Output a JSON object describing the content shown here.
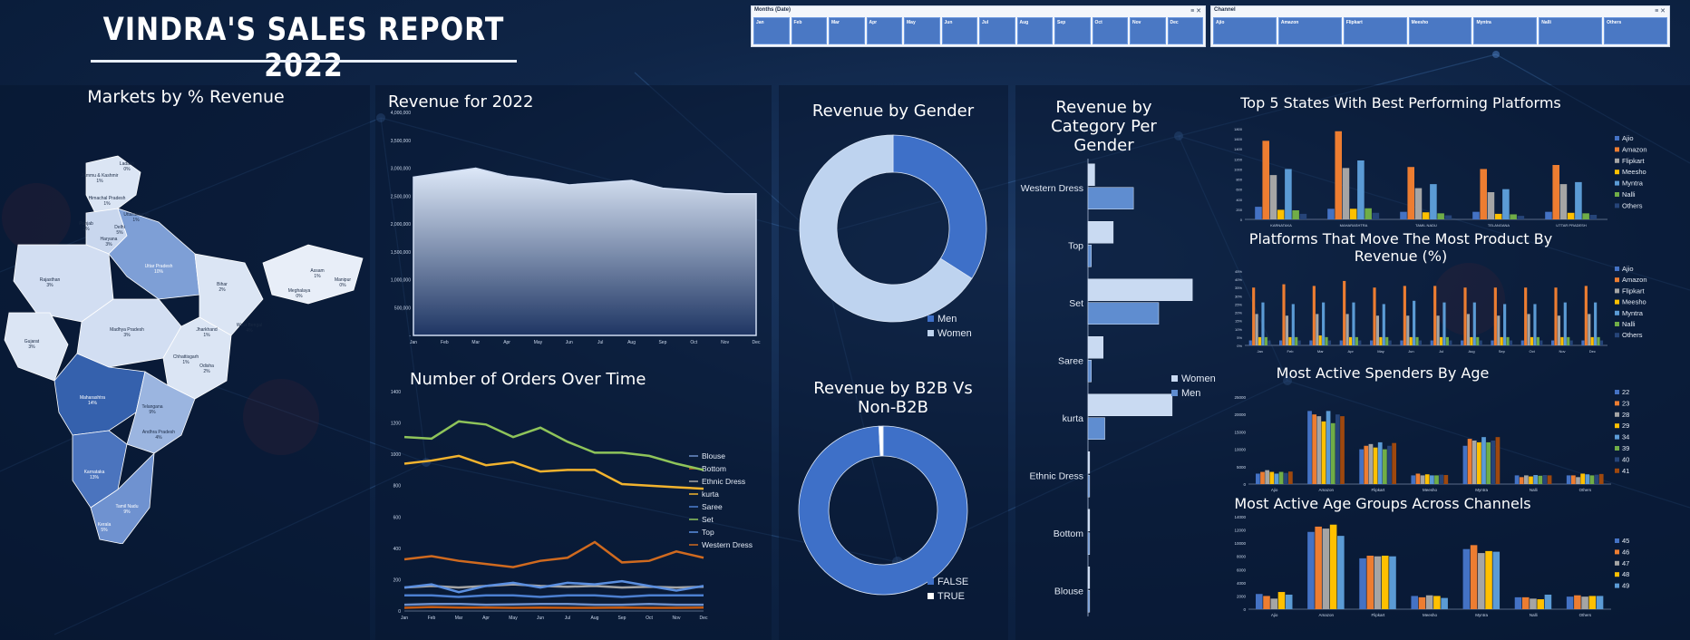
{
  "report_title": "VINDRA'S SALES REPORT 2022",
  "slicers": {
    "months": {
      "header": "Months (Date)",
      "items": [
        "Jan",
        "Feb",
        "Mar",
        "Apr",
        "May",
        "Jun",
        "Jul",
        "Aug",
        "Sep",
        "Oct",
        "Nov",
        "Dec"
      ]
    },
    "channel": {
      "header": "Channel",
      "items": [
        "Ajio",
        "Amazon",
        "Flipkart",
        "Meesho",
        "Myntra",
        "Nalli",
        "Others"
      ]
    }
  },
  "map": {
    "title": "Markets by % Revenue",
    "regions": [
      {
        "name": "Jammu & Kashmir",
        "pct": "1%"
      },
      {
        "name": "Ladakh",
        "pct": "0%"
      },
      {
        "name": "Himachal Pradesh",
        "pct": "1%"
      },
      {
        "name": "Punjab",
        "pct": "2%"
      },
      {
        "name": "Uttarakhand",
        "pct": "1%"
      },
      {
        "name": "Haryana",
        "pct": "3%"
      },
      {
        "name": "Delhi",
        "pct": "5%"
      },
      {
        "name": "Rajasthan",
        "pct": "3%"
      },
      {
        "name": "Uttar Pradesh",
        "pct": "10%"
      },
      {
        "name": "Bihar",
        "pct": "2%"
      },
      {
        "name": "Assam",
        "pct": "1%"
      },
      {
        "name": "Meghalaya",
        "pct": "0%"
      },
      {
        "name": "Manipur",
        "pct": "0%"
      },
      {
        "name": "Gujarat",
        "pct": "3%"
      },
      {
        "name": "Madhya Pradesh",
        "pct": "3%"
      },
      {
        "name": "Jharkhand",
        "pct": "1%"
      },
      {
        "name": "West Bengal",
        "pct": "4%"
      },
      {
        "name": "Chhattisgarh",
        "pct": "1%"
      },
      {
        "name": "Odisha",
        "pct": "2%"
      },
      {
        "name": "Maharashtra",
        "pct": "14%"
      },
      {
        "name": "Telangana",
        "pct": "9%"
      },
      {
        "name": "Andhra Pradesh",
        "pct": "4%"
      },
      {
        "name": "Karnataka",
        "pct": "13%"
      },
      {
        "name": "Tamil Nadu",
        "pct": "9%"
      },
      {
        "name": "Kerala",
        "pct": "5%"
      }
    ]
  },
  "chart_data": [
    {
      "id": "revenue_2022",
      "type": "area",
      "title": "Revenue for 2022",
      "categories": [
        "Jan",
        "Feb",
        "Mar",
        "Apr",
        "May",
        "Jun",
        "Jul",
        "Aug",
        "Sep",
        "Oct",
        "Nov",
        "Dec"
      ],
      "values": [
        2840000,
        2920000,
        3000000,
        2860000,
        2800000,
        2700000,
        2740000,
        2780000,
        2640000,
        2600000,
        2540000,
        2540000
      ],
      "ylim": [
        0,
        4000000
      ],
      "yticks": [
        "-",
        "500,000",
        "1,000,000",
        "1,500,000",
        "2,000,000",
        "2,500,000",
        "3,000,000",
        "3,500,000",
        "4,000,000"
      ],
      "grid": false
    },
    {
      "id": "orders_over_time",
      "type": "line",
      "title": "Number of Orders Over Time",
      "categories": [
        "Jan",
        "Feb",
        "Mar",
        "Apr",
        "May",
        "Jun",
        "Jul",
        "Aug",
        "Sep",
        "Oct",
        "Nov",
        "Dec"
      ],
      "ylim": [
        0,
        1400
      ],
      "yticks": [
        "0",
        "200",
        "400",
        "600",
        "800",
        "1000",
        "1200",
        "1400"
      ],
      "legend": "right",
      "series": [
        {
          "name": "Blouse",
          "color": "#6d8fc9",
          "values": [
            40,
            45,
            45,
            40,
            42,
            45,
            45,
            40,
            40,
            45,
            40,
            40
          ]
        },
        {
          "name": "Bottom",
          "color": "#c55a11",
          "values": [
            20,
            25,
            22,
            22,
            20,
            22,
            20,
            20,
            22,
            20,
            20,
            22
          ]
        },
        {
          "name": "Ethnic Dress",
          "color": "#a5a5a5",
          "values": [
            150,
            160,
            150,
            160,
            170,
            160,
            155,
            160,
            150,
            155,
            150,
            155
          ]
        },
        {
          "name": "kurta",
          "color": "#f2b32e",
          "values": [
            940,
            960,
            990,
            930,
            950,
            890,
            900,
            900,
            810,
            800,
            790,
            780
          ]
        },
        {
          "name": "Saree",
          "color": "#4c7fd0",
          "values": [
            100,
            100,
            90,
            100,
            100,
            90,
            100,
            100,
            90,
            100,
            100,
            100
          ]
        },
        {
          "name": "Set",
          "color": "#8fc45a",
          "values": [
            1110,
            1100,
            1210,
            1190,
            1110,
            1170,
            1080,
            1010,
            1010,
            990,
            940,
            900
          ]
        },
        {
          "name": "Top",
          "color": "#5b8fe0",
          "values": [
            150,
            170,
            120,
            160,
            180,
            150,
            180,
            170,
            190,
            160,
            130,
            160
          ]
        },
        {
          "name": "Western Dress",
          "color": "#d06a1f",
          "values": [
            330,
            350,
            320,
            300,
            280,
            320,
            340,
            440,
            310,
            320,
            380,
            340
          ]
        }
      ]
    },
    {
      "id": "revenue_by_gender",
      "type": "pie",
      "title": "Revenue by Gender",
      "legend": "bottom-right",
      "labels": [
        "Men",
        "Women"
      ],
      "values": [
        34,
        66
      ],
      "colors": [
        "#3e70c8",
        "#bed3ef"
      ]
    },
    {
      "id": "revenue_b2b",
      "type": "pie",
      "title": "Revenue by B2B Vs Non-B2B",
      "legend": "bottom-right",
      "labels": [
        "FALSE",
        "TRUE"
      ],
      "values": [
        99.2,
        0.8
      ],
      "colors": [
        "#3e70c8",
        "#ffffff"
      ]
    },
    {
      "id": "revenue_category_gender",
      "type": "bar",
      "orientation": "horizontal",
      "title": "Revenue by Category Per Gender",
      "categories": [
        "Western Dress",
        "Top",
        "Set",
        "Saree",
        "kurta",
        "Ethnic Dress",
        "Bottom",
        "Blouse"
      ],
      "legend": "right",
      "series": [
        {
          "name": "Women",
          "color": "#c9daf2",
          "values": [
            4,
            15,
            62,
            9,
            50,
            1,
            1,
            1
          ]
        },
        {
          "name": "Men",
          "color": "#5f8dd0",
          "values": [
            27,
            2,
            42,
            2,
            10,
            1,
            1,
            1
          ]
        }
      ]
    },
    {
      "id": "top5_states",
      "type": "bar",
      "title": "Top 5 States With Best Performing Platforms",
      "categories": [
        "KARNATAKA",
        "MAHARASHTRA",
        "TAMIL NADU",
        "TELANGANA",
        "UTTAR PRADESH"
      ],
      "ylim": [
        0,
        1800
      ],
      "yticks": [
        "0",
        "200",
        "400",
        "600",
        "800",
        "1000",
        "1200",
        "1400",
        "1600",
        "1800"
      ],
      "legend": "right",
      "series": [
        {
          "name": "Ajio",
          "color": "#4472c4",
          "values": [
            250,
            210,
            150,
            150,
            150
          ]
        },
        {
          "name": "Amazon",
          "color": "#ed7d31",
          "values": [
            1560,
            1750,
            1040,
            1000,
            1080
          ]
        },
        {
          "name": "Flipkart",
          "color": "#a5a5a5",
          "values": [
            880,
            1020,
            620,
            540,
            700
          ]
        },
        {
          "name": "Meesho",
          "color": "#ffc000",
          "values": [
            190,
            210,
            140,
            110,
            130
          ]
        },
        {
          "name": "Myntra",
          "color": "#5b9bd5",
          "values": [
            1000,
            1170,
            700,
            600,
            740
          ]
        },
        {
          "name": "Nalli",
          "color": "#70ad47",
          "values": [
            180,
            220,
            120,
            100,
            120
          ]
        },
        {
          "name": "Others",
          "color": "#264478",
          "values": [
            110,
            130,
            80,
            70,
            90
          ]
        }
      ]
    },
    {
      "id": "platforms_move_product",
      "type": "bar",
      "title": "Platforms That Move The Most Product By Revenue (%)",
      "categories": [
        "Jan",
        "Feb",
        "Mar",
        "Apr",
        "May",
        "Jun",
        "Jul",
        "Aug",
        "Sep",
        "Oct",
        "Nov",
        "Dec"
      ],
      "ylim": [
        0,
        45
      ],
      "yticks": [
        "0%",
        "5%",
        "10%",
        "15%",
        "20%",
        "25%",
        "30%",
        "35%",
        "40%",
        "45%"
      ],
      "legend": "right",
      "series": [
        {
          "name": "Ajio",
          "color": "#4472c4",
          "values": [
            3,
            3,
            3,
            3,
            3,
            3,
            3,
            3,
            3,
            3,
            3,
            3
          ]
        },
        {
          "name": "Amazon",
          "color": "#ed7d31",
          "values": [
            35,
            37,
            36,
            39,
            35,
            36,
            36,
            35,
            35,
            35,
            35,
            36
          ]
        },
        {
          "name": "Flipkart",
          "color": "#a5a5a5",
          "values": [
            19,
            18,
            19,
            19,
            18,
            18,
            18,
            19,
            18,
            19,
            18,
            19
          ]
        },
        {
          "name": "Meesho",
          "color": "#ffc000",
          "values": [
            5,
            5,
            6,
            5,
            5,
            5,
            5,
            5,
            5,
            5,
            5,
            5
          ]
        },
        {
          "name": "Myntra",
          "color": "#5b9bd5",
          "values": [
            26,
            25,
            26,
            26,
            25,
            27,
            26,
            26,
            25,
            25,
            26,
            26
          ]
        },
        {
          "name": "Nalli",
          "color": "#70ad47",
          "values": [
            5,
            5,
            5,
            5,
            5,
            5,
            5,
            5,
            5,
            5,
            5,
            5
          ]
        },
        {
          "name": "Others",
          "color": "#264478",
          "values": [
            3,
            3,
            3,
            3,
            3,
            3,
            3,
            3,
            3,
            3,
            3,
            3
          ]
        }
      ]
    },
    {
      "id": "active_spenders_age",
      "type": "bar",
      "title": "Most Active Spenders By Age",
      "categories": [
        "Ajio",
        "Amazon",
        "Flipkart",
        "Meesho",
        "Myntra",
        "Nalli",
        "Others"
      ],
      "ylim": [
        0,
        25000
      ],
      "yticks": [
        "0",
        "5000",
        "10000",
        "15000",
        "20000",
        "25000"
      ],
      "legend": "right",
      "series": [
        {
          "name": "22",
          "color": "#4472c4",
          "values": [
            3000,
            21000,
            10000,
            2500,
            11000,
            2500,
            2500
          ]
        },
        {
          "name": "23",
          "color": "#ed7d31",
          "values": [
            3500,
            20000,
            11000,
            3000,
            13000,
            2000,
            2500
          ]
        },
        {
          "name": "28",
          "color": "#a5a5a5",
          "values": [
            4000,
            19500,
            11500,
            2500,
            12500,
            2500,
            2000
          ]
        },
        {
          "name": "29",
          "color": "#ffc000",
          "values": [
            3500,
            18000,
            10500,
            2800,
            12000,
            2200,
            3000
          ]
        },
        {
          "name": "34",
          "color": "#5b9bd5",
          "values": [
            3000,
            21000,
            12000,
            2500,
            13500,
            2600,
            2800
          ]
        },
        {
          "name": "39",
          "color": "#70ad47",
          "values": [
            3500,
            17500,
            10000,
            2500,
            12000,
            2400,
            2500
          ]
        },
        {
          "name": "40",
          "color": "#264478",
          "values": [
            3200,
            20000,
            11000,
            2700,
            12500,
            2600,
            2700
          ]
        },
        {
          "name": "41",
          "color": "#9e480e",
          "values": [
            3600,
            19500,
            11800,
            2600,
            13500,
            2500,
            2900
          ]
        }
      ]
    },
    {
      "id": "active_age_groups",
      "type": "bar",
      "title": "Most Active Age Groups Across Channels",
      "categories": [
        "Ajio",
        "Amazon",
        "Flipkart",
        "Meesho",
        "Myntra",
        "Nalli",
        "Others"
      ],
      "ylim": [
        0,
        14000
      ],
      "yticks": [
        "0",
        "2000",
        "4000",
        "6000",
        "8000",
        "10000",
        "12000",
        "14000"
      ],
      "legend": "right",
      "series": [
        {
          "name": "45",
          "color": "#4472c4",
          "values": [
            2300,
            11700,
            7700,
            2000,
            9100,
            1800,
            1900
          ]
        },
        {
          "name": "46",
          "color": "#ed7d31",
          "values": [
            2000,
            12500,
            8100,
            1800,
            9700,
            1800,
            2100
          ]
        },
        {
          "name": "47",
          "color": "#a5a5a5",
          "values": [
            1600,
            12200,
            8000,
            2100,
            8500,
            1600,
            1900
          ]
        },
        {
          "name": "48",
          "color": "#ffc000",
          "values": [
            2600,
            12800,
            8100,
            2000,
            8800,
            1500,
            2000
          ]
        },
        {
          "name": "49",
          "color": "#5b9bd5",
          "values": [
            2200,
            11100,
            8000,
            1700,
            8700,
            2200,
            2000
          ]
        }
      ]
    }
  ]
}
